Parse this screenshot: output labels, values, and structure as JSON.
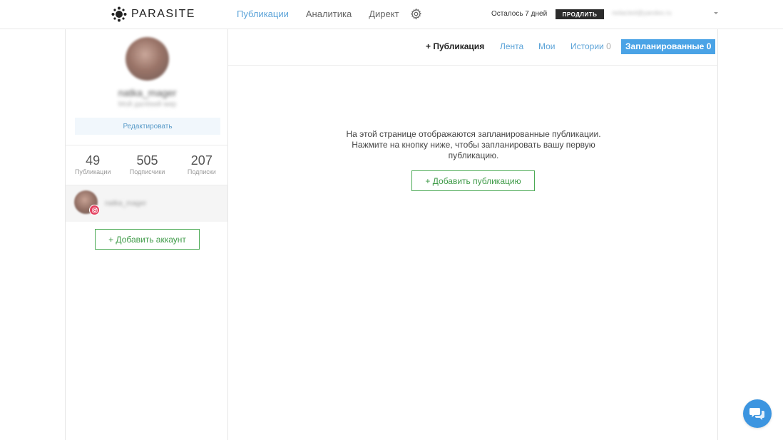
{
  "header": {
    "brand": "PARASITE",
    "nav": [
      {
        "label": "Публикации",
        "active": true
      },
      {
        "label": "Аналитика",
        "active": false
      },
      {
        "label": "Директ",
        "active": false
      }
    ],
    "trial_text": "Осталось 7 дней",
    "renew_label": "ПРОДЛИТЬ",
    "user_email": "redacted@yandex.ru",
    "accent_color": "#5ba3d8"
  },
  "sidebar": {
    "profile_name": "natka_mager",
    "profile_bio": "Мой далёкий мир",
    "edit_label": "Редактировать",
    "stats": [
      {
        "value": "49",
        "label": "Публикации"
      },
      {
        "value": "505",
        "label": "Подписчики"
      },
      {
        "value": "207",
        "label": "Подписки"
      }
    ],
    "account": {
      "name": "natka_mager",
      "network_icon": "instagram-icon"
    },
    "add_account_label": "+ Добавить аккаунт"
  },
  "main": {
    "tabs": {
      "new": {
        "label": "+ Публикация"
      },
      "feed": {
        "label": "Лента"
      },
      "mine": {
        "label": "Мои"
      },
      "stories": {
        "label": "Истории",
        "count": "0"
      },
      "scheduled": {
        "label": "Запланированные",
        "count": "0",
        "active": true
      }
    },
    "empty_lines": [
      "На этой странице отображаются запланированные публикации.",
      "Нажмите на кнопку ниже, чтобы запланировать вашу первую",
      "публикацию."
    ],
    "add_publication_label": "+ Добавить публикацию"
  },
  "chat": {
    "icon": "chat-bubbles-icon",
    "color": "#3c95e0"
  }
}
